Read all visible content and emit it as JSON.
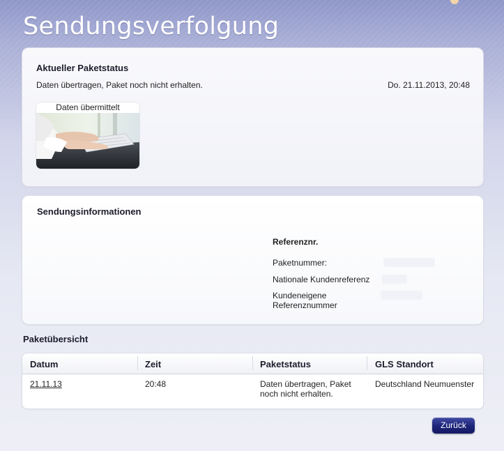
{
  "page": {
    "title": "Sendungsverfolgung"
  },
  "status_panel": {
    "heading": "Aktueller Paketstatus",
    "status_text": "Daten übertragen, Paket noch nicht erhalten.",
    "datetime": "Do. 21.11.2013, 20:48",
    "image_label": "Daten übermittelt"
  },
  "info_panel": {
    "heading": "Sendungsinformationen",
    "reference_heading": "Referenznr.",
    "labels": {
      "package_number": "Paketnummer:",
      "national_customer_ref": "Nationale Kundenreferenz",
      "customer_ref_line1": "Kundeneigene",
      "customer_ref_line2": "Referenznummer"
    }
  },
  "overview": {
    "heading": "Paketübersicht",
    "columns": [
      "Datum",
      "Zeit",
      "Paketstatus",
      "GLS Standort"
    ],
    "rows": [
      {
        "date": "21.11.13",
        "time": "20:48",
        "status_line1": "Daten übertragen, Paket",
        "status_line2": "noch nicht erhalten.",
        "location": "Deutschland Neumuenster"
      }
    ]
  },
  "buttons": {
    "back": "Zurück"
  },
  "colors": {
    "button_blue": "#1d2478",
    "header_bg": "#a9afd6"
  }
}
